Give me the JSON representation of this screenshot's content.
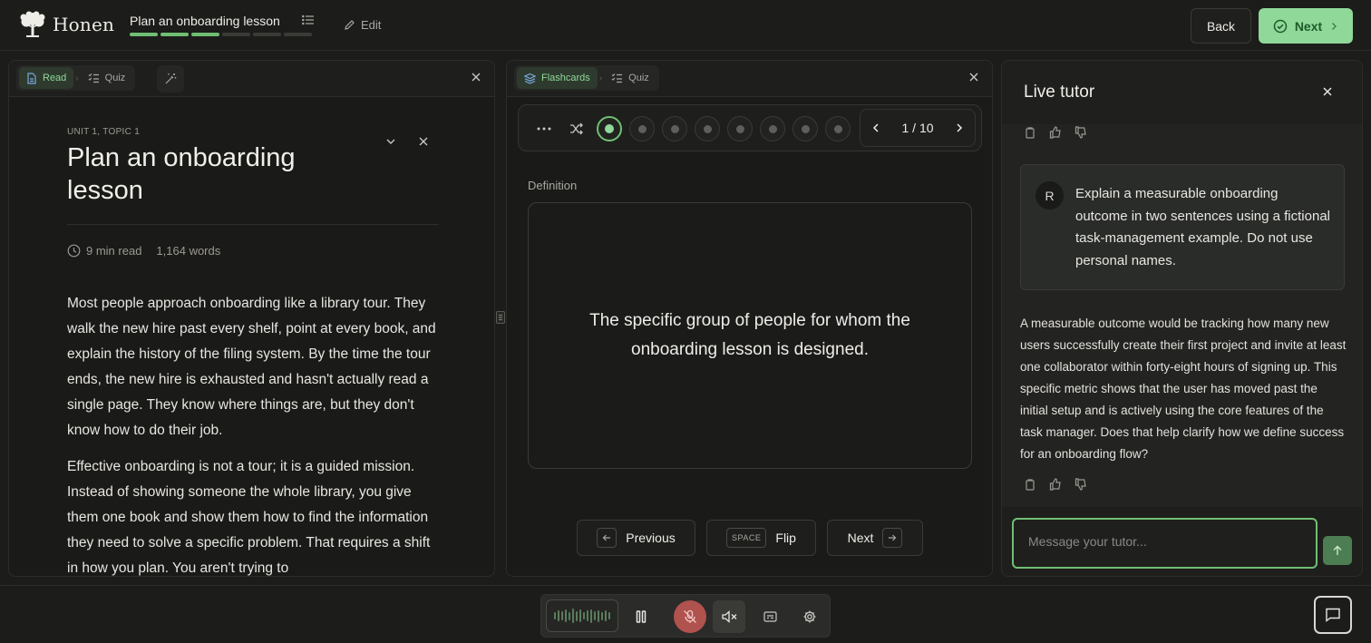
{
  "app": {
    "name": "Honen"
  },
  "header": {
    "lesson_title": "Plan an onboarding lesson",
    "edit_label": "Edit",
    "back_label": "Back",
    "next_label": "Next",
    "progress": {
      "completed": 3,
      "total": 6
    }
  },
  "read_panel": {
    "tabs": [
      {
        "label": "Read",
        "icon": "document-icon",
        "active": true
      },
      {
        "label": "Quiz",
        "icon": "checklist-icon",
        "active": false
      }
    ],
    "unit_label": "UNIT 1, TOPIC 1",
    "title": "Plan an onboarding lesson",
    "read_time": "9 min read",
    "word_count": "1,164 words",
    "paragraphs": [
      "Most people approach onboarding like a library tour. They walk the new hire past every shelf, point at every book, and explain the history of the filing system. By the time the tour ends, the new hire is exhausted and hasn't actually read a single page. They know where things are, but they don't know how to do their job.",
      "Effective onboarding is not a tour; it is a guided mission. Instead of showing someone the whole library, you give them one book and show them how to find the information they need to solve a specific problem. That requires a shift in how you plan. You aren't trying to"
    ]
  },
  "flashcards_panel": {
    "tabs": [
      {
        "label": "Flashcards",
        "icon": "stack-icon",
        "active": true
      },
      {
        "label": "Quiz",
        "icon": "checklist-icon",
        "active": false
      }
    ],
    "current": 1,
    "total": 10,
    "pager_text": "1 / 10",
    "card_label": "Definition",
    "card_text": "The specific group of people for whom the onboarding lesson is designed.",
    "prev_label": "Previous",
    "flip_key": "SPACE",
    "flip_label": "Flip",
    "next_label": "Next"
  },
  "tutor": {
    "title": "Live tutor",
    "user_initial": "R",
    "user_message": "Explain a measurable onboarding outcome in two sentences using a fictional task-management example. Do not use personal names.",
    "ai_message": "A measurable outcome would be tracking how many new users successfully create their first project and invite at least one collaborator within forty-eight hours of signing up. This specific metric shows that the user has moved past the initial setup and is actively using the core features of the task manager. Does that help clarify how we define success for an onboarding flow?",
    "input_placeholder": "Message your tutor..."
  },
  "colors": {
    "accent": "#8fd89a",
    "accent_dark": "#6fbf73",
    "background": "#1c1c1a",
    "mic_off": "#b0524e"
  }
}
